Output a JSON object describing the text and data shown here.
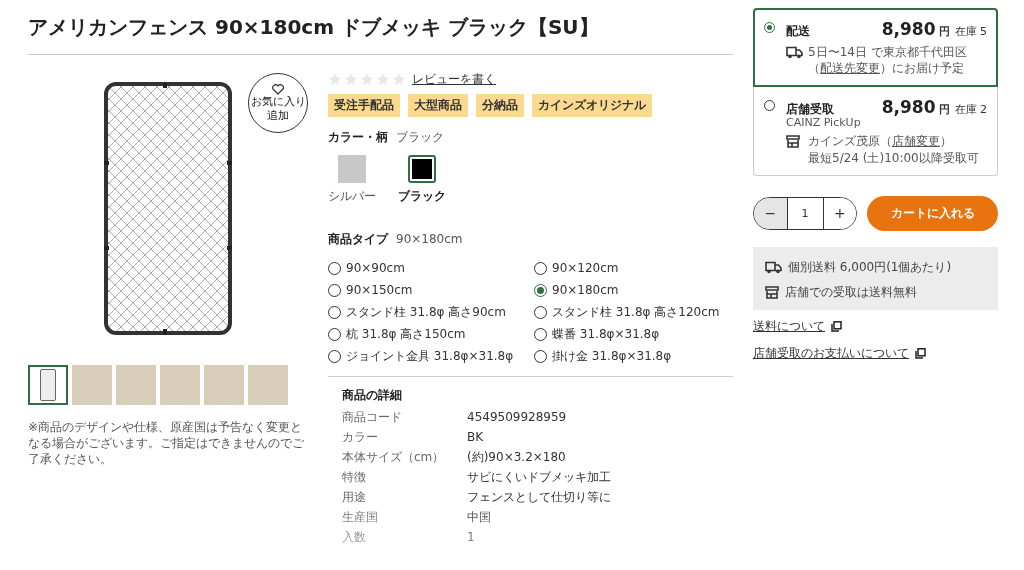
{
  "title": "アメリカンフェンス 90×180cm ドブメッキ ブラック【SU】",
  "favorite": {
    "lines": [
      "お気に入り",
      "追加"
    ]
  },
  "gallery": {
    "thumbnails": [
      {
        "kind": "drawing",
        "selected": true
      },
      {
        "kind": "photo",
        "selected": false
      },
      {
        "kind": "photo",
        "selected": false
      },
      {
        "kind": "photo",
        "selected": false
      },
      {
        "kind": "photo",
        "selected": false
      },
      {
        "kind": "photo",
        "selected": false
      }
    ]
  },
  "note": "※商品のデザインや仕様、原産国は予告なく変更となる場合がございます。ご指定はできませんのでご了承ください。",
  "rating": {
    "stars": 0,
    "link": "レビューを書く"
  },
  "tags": [
    "受注手配品",
    "大型商品",
    "分納品",
    "カインズオリジナル"
  ],
  "color": {
    "label": "カラー・柄",
    "value": "ブラック",
    "swatches": [
      {
        "name": "シルバー",
        "selected": false,
        "color": "#c8c8c8"
      },
      {
        "name": "ブラック",
        "selected": true,
        "color": "#000000"
      }
    ]
  },
  "product_type": {
    "label": "商品タイプ",
    "value": "90×180cm",
    "options": [
      {
        "label": "90×90cm",
        "selected": false
      },
      {
        "label": "90×120cm",
        "selected": false
      },
      {
        "label": "90×150cm",
        "selected": false
      },
      {
        "label": "90×180cm",
        "selected": true
      },
      {
        "label": "スタンド柱 31.8φ 高さ90cm",
        "selected": false
      },
      {
        "label": "スタンド柱 31.8φ 高さ120cm",
        "selected": false
      },
      {
        "label": "杭 31.8φ 高さ150cm",
        "selected": false
      },
      {
        "label": "蝶番 31.8φ×31.8φ",
        "selected": false
      },
      {
        "label": "ジョイント金具 31.8φ×31.8φ",
        "selected": false
      },
      {
        "label": "掛け金 31.8φ×31.8φ",
        "selected": false
      }
    ]
  },
  "details": {
    "title": "商品の詳細",
    "rows": [
      {
        "key": "商品コード",
        "value": "4549509928959"
      },
      {
        "key": "カラー",
        "value": "BK"
      },
      {
        "key": "本体サイズ（cm）",
        "value": "(約)90×3.2×180"
      },
      {
        "key": "特徴",
        "value": "サビにくいドブメッキ加工"
      },
      {
        "key": "用途",
        "value": "フェンスとして仕切り等に"
      },
      {
        "key": "生産国",
        "value": "中国"
      },
      {
        "key": "入数",
        "value": "1"
      }
    ]
  },
  "delivery_options": [
    {
      "kind": "delivery",
      "title": "配送",
      "selected": true,
      "price": "8,980",
      "currency": "円",
      "stock": "在庫 5",
      "info_before": "5日〜14日 で東京都千代田区（",
      "link": "配送先変更",
      "info_after": "）にお届け予定"
    },
    {
      "kind": "pickup",
      "title": "店舗受取",
      "selected": false,
      "subtitle": "CAINZ PickUp",
      "price": "8,980",
      "currency": "円",
      "stock": "在庫 2",
      "info_before": "カインズ茂原（",
      "link": "店舗変更",
      "info_after": "）",
      "extra": "最短5/24 (土)10:00以降受取可"
    }
  ],
  "quantity": {
    "minus": "−",
    "value": "1",
    "plus": "+",
    "minus_disabled": true
  },
  "cart_button": "カートに入れる",
  "shipping_info": [
    {
      "kind": "delivery",
      "text": "個別送料 6,000円(1個あたり)"
    },
    {
      "kind": "pickup",
      "text": "店舗での受取は送料無料"
    }
  ],
  "links": [
    "送料について",
    "店舗受取のお支払いについて"
  ]
}
